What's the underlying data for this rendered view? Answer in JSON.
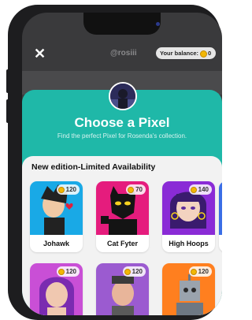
{
  "header": {
    "username": "@rosiii",
    "balance_label": "Your balance:",
    "balance_value": "0"
  },
  "sheet": {
    "title": "Choose a Pixel",
    "subtitle": "Find the perfect Pixel for Rosenda's collection."
  },
  "section": {
    "title": "New edition-Limited Availability"
  },
  "cards_row1": [
    {
      "name": "Johawk",
      "price": "120",
      "bg": "#19a9e6"
    },
    {
      "name": "Cat Fyter",
      "price": "70",
      "bg": "#e51c7d"
    },
    {
      "name": "High Hoops",
      "price": "140",
      "bg": "#8a2bd6"
    }
  ],
  "cards_row2": [
    {
      "price": "120",
      "bg": "#c94fd6"
    },
    {
      "price": "120",
      "bg": "#9b5bd0"
    },
    {
      "price": "120",
      "bg": "#ff7f1f"
    }
  ],
  "colors": {
    "sheet": "#1fb8a8",
    "coin": "#f2b705"
  }
}
